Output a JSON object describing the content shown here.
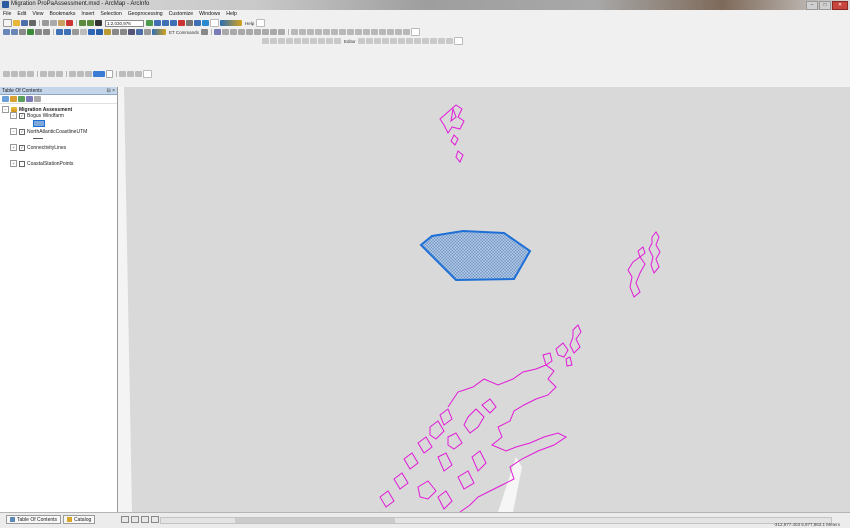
{
  "window": {
    "title": "Migration ProPaAssessment.mxd - ArcMap - ArcInfo",
    "buttons": [
      "–",
      "□",
      "✕"
    ]
  },
  "menu": [
    "File",
    "Edit",
    "View",
    "Bookmarks",
    "Insert",
    "Selection",
    "Geoprocessing",
    "Customize",
    "Windows",
    "Help"
  ],
  "toolbar": {
    "scale": "1:2,030,976",
    "help_label": "Help",
    "commands_label": "ET Commands",
    "editor_label": "Editor"
  },
  "toc": {
    "title": "Table Of Contents",
    "header_buttons": "⊟ ×",
    "root_label": "Migration Assessment",
    "layers": [
      {
        "label": "Bogus Windfarm",
        "checked": true
      },
      {
        "label": "NorthAtlanticCoastlineUTM",
        "checked": true
      },
      {
        "label": "ConnectivityLines",
        "checked": true
      },
      {
        "label": "CoastalStationPoints",
        "checked": false
      }
    ]
  },
  "status": {
    "tabs": [
      "Table Of Contents",
      "Catalog"
    ],
    "coordinates": "-312,977.403  6,977,863.1 Meters"
  },
  "colors": {
    "coastline": "#e21ad8",
    "windfarm_fill": "#8fb4df",
    "windfarm_stroke": "#1e6fd6",
    "map_background": "#d9d9d9"
  }
}
